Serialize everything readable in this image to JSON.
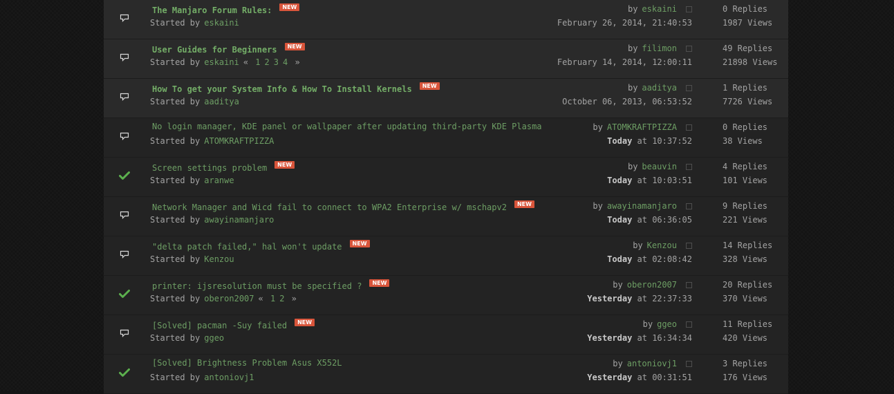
{
  "topics": [
    {
      "type": "sticky",
      "icon": "speech-bubble-icon",
      "title": "The Manjaro Forum Rules:",
      "new": true,
      "new_label": "NEW",
      "started_label": "Started by",
      "starter": "eskaini",
      "pages": [],
      "by_label": "by",
      "last_user": "eskaini",
      "date_bold": "",
      "date_rest": "February 26, 2014, 21:40:53",
      "replies": "0 Replies",
      "views": "1987 Views"
    },
    {
      "type": "sticky",
      "icon": "speech-bubble-icon",
      "title": "User Guides for Beginners",
      "new": true,
      "new_label": "NEW",
      "started_label": "Started by",
      "starter": "eskaini",
      "pages": [
        "1",
        "2",
        "3",
        "4"
      ],
      "by_label": "by",
      "last_user": "filimon",
      "date_bold": "",
      "date_rest": "February 14, 2014, 12:00:11",
      "replies": "49 Replies",
      "views": "21898 Views"
    },
    {
      "type": "sticky",
      "icon": "speech-bubble-icon",
      "title": "How To get your System Info & How To Install Kernels",
      "new": true,
      "new_label": "NEW",
      "started_label": "Started by",
      "starter": "aaditya",
      "pages": [],
      "by_label": "by",
      "last_user": "aaditya",
      "date_bold": "",
      "date_rest": "October 06, 2013, 06:53:52",
      "replies": "1 Replies",
      "views": "7726 Views"
    },
    {
      "type": "normal",
      "icon": "speech-bubble-icon",
      "title": "No login manager, KDE panel or wallpaper after updating third-party KDE Plasma",
      "new": false,
      "new_label": "",
      "started_label": "Started by",
      "starter": "ATOMKRAFTPIZZA",
      "pages": [],
      "by_label": "by",
      "last_user": "ATOMKRAFTPIZZA",
      "date_bold": "Today",
      "date_rest": " at 10:37:52",
      "replies": "0 Replies",
      "views": "38 Views"
    },
    {
      "type": "normal",
      "icon": "checkmark-icon",
      "title": "Screen settings problem",
      "new": true,
      "new_label": "NEW",
      "started_label": "Started by",
      "starter": "aranwe",
      "pages": [],
      "by_label": "by",
      "last_user": "beauvin",
      "date_bold": "Today",
      "date_rest": " at 10:03:51",
      "replies": "4 Replies",
      "views": "101 Views"
    },
    {
      "type": "normal",
      "icon": "speech-bubble-icon",
      "title": "Network Manager and Wicd fail to connect to WPA2 Enterprise w/ mschapv2",
      "new": true,
      "new_label": "NEW",
      "started_label": "Started by",
      "starter": "awayinamanjaro",
      "pages": [],
      "by_label": "by",
      "last_user": "awayinamanjaro",
      "date_bold": "Today",
      "date_rest": " at 06:36:05",
      "replies": "9 Replies",
      "views": "221 Views"
    },
    {
      "type": "normal",
      "icon": "speech-bubble-icon",
      "title": "\"delta patch failed,\" hal won't update",
      "new": true,
      "new_label": "NEW",
      "started_label": "Started by",
      "starter": "Kenzou",
      "pages": [],
      "by_label": "by",
      "last_user": "Kenzou",
      "date_bold": "Today",
      "date_rest": " at 02:08:42",
      "replies": "14 Replies",
      "views": "328 Views"
    },
    {
      "type": "normal",
      "icon": "checkmark-icon",
      "title": "printer: ijsresolution must be specified ?",
      "new": true,
      "new_label": "NEW",
      "started_label": "Started by",
      "starter": "oberon2007",
      "pages": [
        "1",
        "2"
      ],
      "by_label": "by",
      "last_user": "oberon2007",
      "date_bold": "Yesterday",
      "date_rest": " at 22:37:33",
      "replies": "20 Replies",
      "views": "370 Views"
    },
    {
      "type": "normal",
      "icon": "speech-bubble-icon",
      "title": "[Solved] pacman -Suy failed",
      "new": true,
      "new_label": "NEW",
      "started_label": "Started by",
      "starter": "ggeo",
      "pages": [],
      "by_label": "by",
      "last_user": "ggeo",
      "date_bold": "Yesterday",
      "date_rest": " at 16:34:34",
      "replies": "11 Replies",
      "views": "420 Views"
    },
    {
      "type": "normal",
      "icon": "checkmark-icon",
      "title": "[Solved] Brightness Problem Asus X552L",
      "new": false,
      "new_label": "",
      "started_label": "Started by",
      "starter": "antoniovj1",
      "pages": [],
      "by_label": "by",
      "last_user": "antoniovj1",
      "date_bold": "Yesterday",
      "date_rest": " at 00:31:51",
      "replies": "3 Replies",
      "views": "176 Views"
    }
  ],
  "page_nav": {
    "prev": "«",
    "next": "»"
  },
  "colors": {
    "link": "#6d9e64",
    "badge": "#d9553b",
    "text": "#a3a3a3",
    "check": "#5cb04e"
  }
}
